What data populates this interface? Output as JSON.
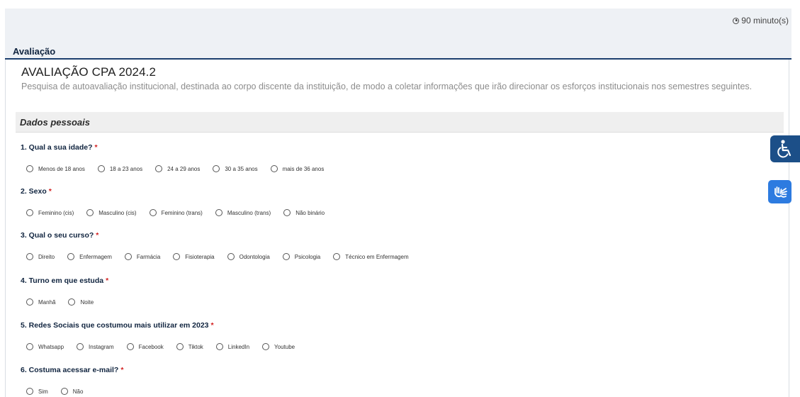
{
  "header": {
    "timer_text": "90 minuto(s)"
  },
  "section": {
    "label": "Avaliação"
  },
  "form": {
    "title": "AVALIAÇÃO CPA 2024.2",
    "description": "Pesquisa de autoavaliação institucional, destinada ao corpo discente da instituição, de modo a coletar informações que irão direcionar os esforços institucionais nos semestres seguintes."
  },
  "group": {
    "title": "Dados pessoais"
  },
  "questions": [
    {
      "label": "1. Qual a sua idade?",
      "required": "*",
      "options": [
        "Menos de 18 anos",
        "18 a 23 anos",
        "24 a 29 anos",
        "30 a 35 anos",
        "mais de 36 anos"
      ]
    },
    {
      "label": "2. Sexo",
      "required": "*",
      "options": [
        "Feminino (cis)",
        "Masculino (cis)",
        "Feminino (trans)",
        "Masculino (trans)",
        "Não binário"
      ]
    },
    {
      "label": "3. Qual o seu curso?",
      "required": "*",
      "options": [
        "Direito",
        "Enfermagem",
        "Farmácia",
        "Fisioterapia",
        "Odontologia",
        "Psicologia",
        "Técnico em Enfermagem"
      ]
    },
    {
      "label": "4. Turno em que estuda",
      "required": "*",
      "options": [
        "Manhã",
        "Noite"
      ]
    },
    {
      "label": "5. Redes Sociais que costumou mais utilizar em 2023",
      "required": "*",
      "options": [
        "Whatsapp",
        "Instagram",
        "Facebook",
        "Tiktok",
        "LinkedIn",
        "Youtube"
      ]
    },
    {
      "label": "6. Costuma acessar e-mail?",
      "required": "*",
      "options": [
        "Sim",
        "Não"
      ]
    }
  ],
  "colors": {
    "navy": "#1c3f6e",
    "required": "#d21f1f",
    "accessibility_button": "#1c4f88",
    "libras_button": "#2d7be0"
  },
  "icons": {
    "timer": "clock-icon",
    "accessibility": "wheelchair-icon",
    "sign_language": "sign-language-hands-icon"
  }
}
